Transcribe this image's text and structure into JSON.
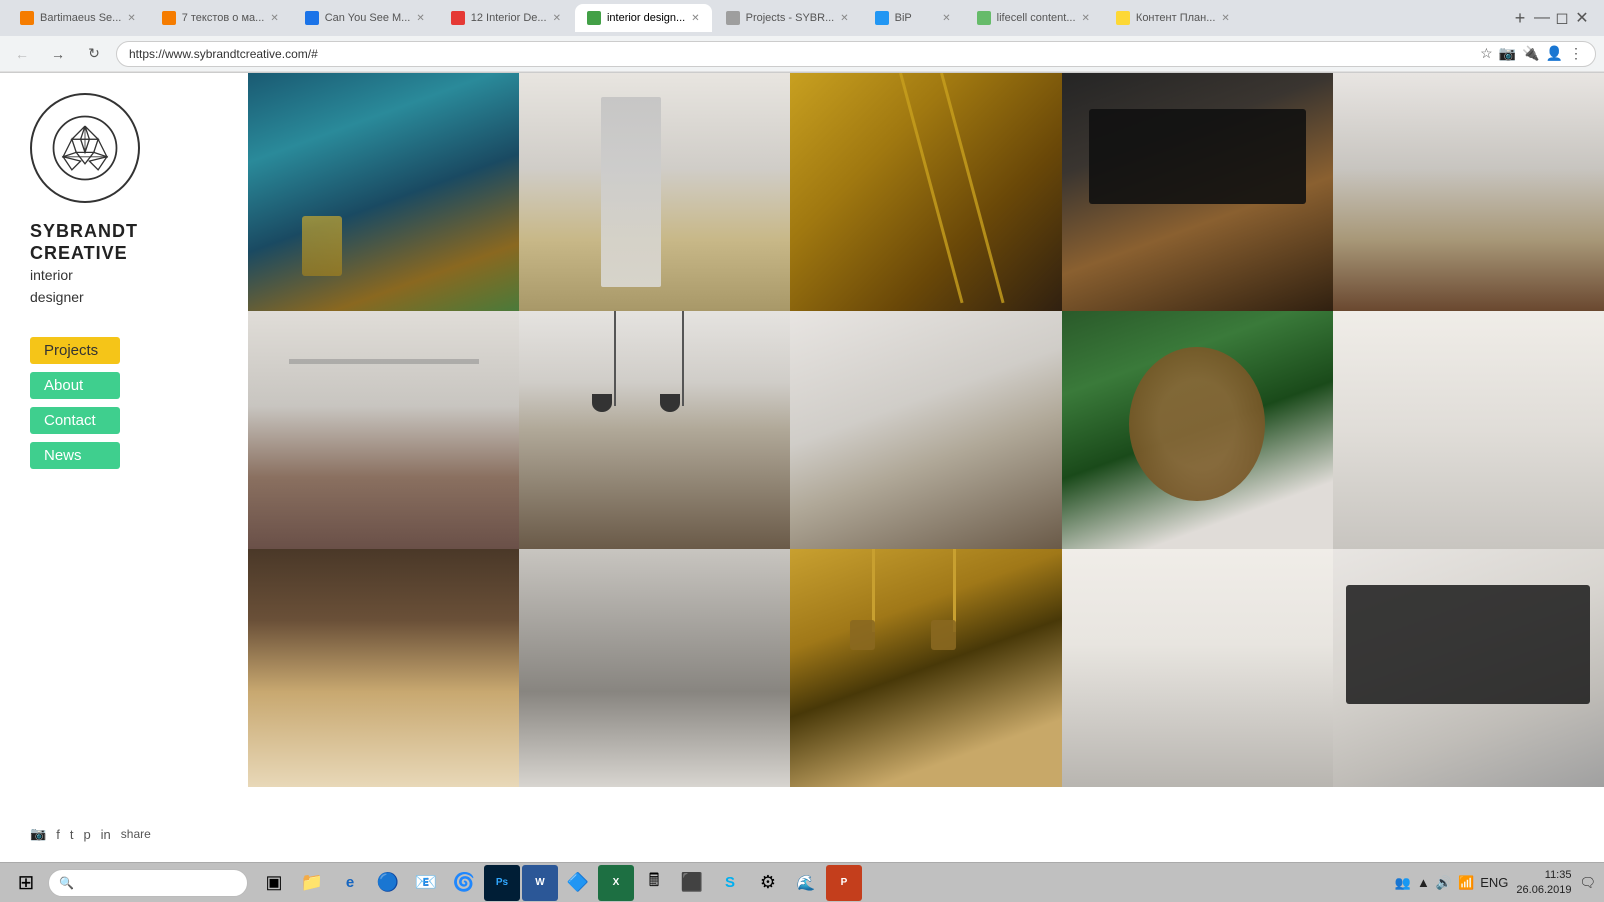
{
  "browser": {
    "url": "https://www.sybrandtcreative.com/#",
    "tabs": [
      {
        "id": "tab1",
        "title": "Bartimaeus Se...",
        "favicon_color": "#f57c00",
        "active": false
      },
      {
        "id": "tab2",
        "title": "7 текстов о ма...",
        "favicon_color": "#f57c00",
        "active": false
      },
      {
        "id": "tab3",
        "title": "Can You See M...",
        "favicon_color": "#1a73e8",
        "active": false
      },
      {
        "id": "tab4",
        "title": "12 Interior De...",
        "favicon_color": "#e53935",
        "active": false
      },
      {
        "id": "tab5",
        "title": "interior design...",
        "favicon_color": "#43a047",
        "active": true
      },
      {
        "id": "tab6",
        "title": "Projects - SYBR...",
        "favicon_color": "#9e9e9e",
        "active": false
      },
      {
        "id": "tab7",
        "title": "BiP",
        "favicon_color": "#2196f3",
        "active": false
      },
      {
        "id": "tab8",
        "title": "lifecell content...",
        "favicon_color": "#66bb6a",
        "active": false
      },
      {
        "id": "tab9",
        "title": "Контент План...",
        "favicon_color": "#fdd835",
        "active": false
      }
    ]
  },
  "sidebar": {
    "brand_line1": "SYBRANDT",
    "brand_line2": "CREATIVE",
    "brand_sub1": "interior",
    "brand_sub2": "designer",
    "nav_items": [
      {
        "id": "projects",
        "label": "Projects",
        "style": "projects"
      },
      {
        "id": "about",
        "label": "About",
        "style": "green"
      },
      {
        "id": "contact",
        "label": "Contact",
        "style": "green"
      },
      {
        "id": "news",
        "label": "News",
        "style": "green"
      }
    ],
    "social": {
      "instagram": "instagram-icon",
      "facebook": "facebook-icon",
      "twitter": "twitter-icon",
      "pinterest": "pinterest-icon",
      "linkedin": "linkedin-icon",
      "share_label": "share"
    }
  },
  "grid": {
    "items": [
      {
        "id": 1,
        "css_class": "photo-1"
      },
      {
        "id": 2,
        "css_class": "photo-2"
      },
      {
        "id": 3,
        "css_class": "photo-3"
      },
      {
        "id": 4,
        "css_class": "photo-4"
      },
      {
        "id": 5,
        "css_class": "photo-5"
      },
      {
        "id": 6,
        "css_class": "photo-6"
      },
      {
        "id": 7,
        "css_class": "photo-7"
      },
      {
        "id": 8,
        "css_class": "photo-8"
      },
      {
        "id": 9,
        "css_class": "photo-9"
      },
      {
        "id": 10,
        "css_class": "photo-10"
      },
      {
        "id": 11,
        "css_class": "photo-11"
      },
      {
        "id": 12,
        "css_class": "photo-12"
      },
      {
        "id": 13,
        "css_class": "photo-13"
      },
      {
        "id": 14,
        "css_class": "photo-14"
      },
      {
        "id": 15,
        "css_class": "photo-15"
      }
    ]
  },
  "taskbar": {
    "time": "11:35",
    "date": "26.06.2019",
    "language": "ENG",
    "apps": [
      {
        "name": "start",
        "icon": "⊞"
      },
      {
        "name": "search",
        "icon": "🔍",
        "placeholder": ""
      },
      {
        "name": "task-view",
        "icon": "▣"
      },
      {
        "name": "file-explorer",
        "icon": "📁"
      },
      {
        "name": "ie",
        "icon": "🌐"
      },
      {
        "name": "app3",
        "icon": "🔵"
      },
      {
        "name": "outlook",
        "icon": "📧"
      },
      {
        "name": "chrome",
        "icon": "🌀"
      },
      {
        "name": "photoshop",
        "icon": "🖼"
      },
      {
        "name": "word",
        "icon": "W"
      },
      {
        "name": "app8",
        "icon": "🔷"
      },
      {
        "name": "excel",
        "icon": "X"
      },
      {
        "name": "calculator",
        "icon": "🖩"
      },
      {
        "name": "app10",
        "icon": "⬛"
      },
      {
        "name": "skype",
        "icon": "S"
      },
      {
        "name": "settings",
        "icon": "⚙"
      },
      {
        "name": "edge",
        "icon": "🌊"
      },
      {
        "name": "powerpoint",
        "icon": "P"
      }
    ]
  }
}
